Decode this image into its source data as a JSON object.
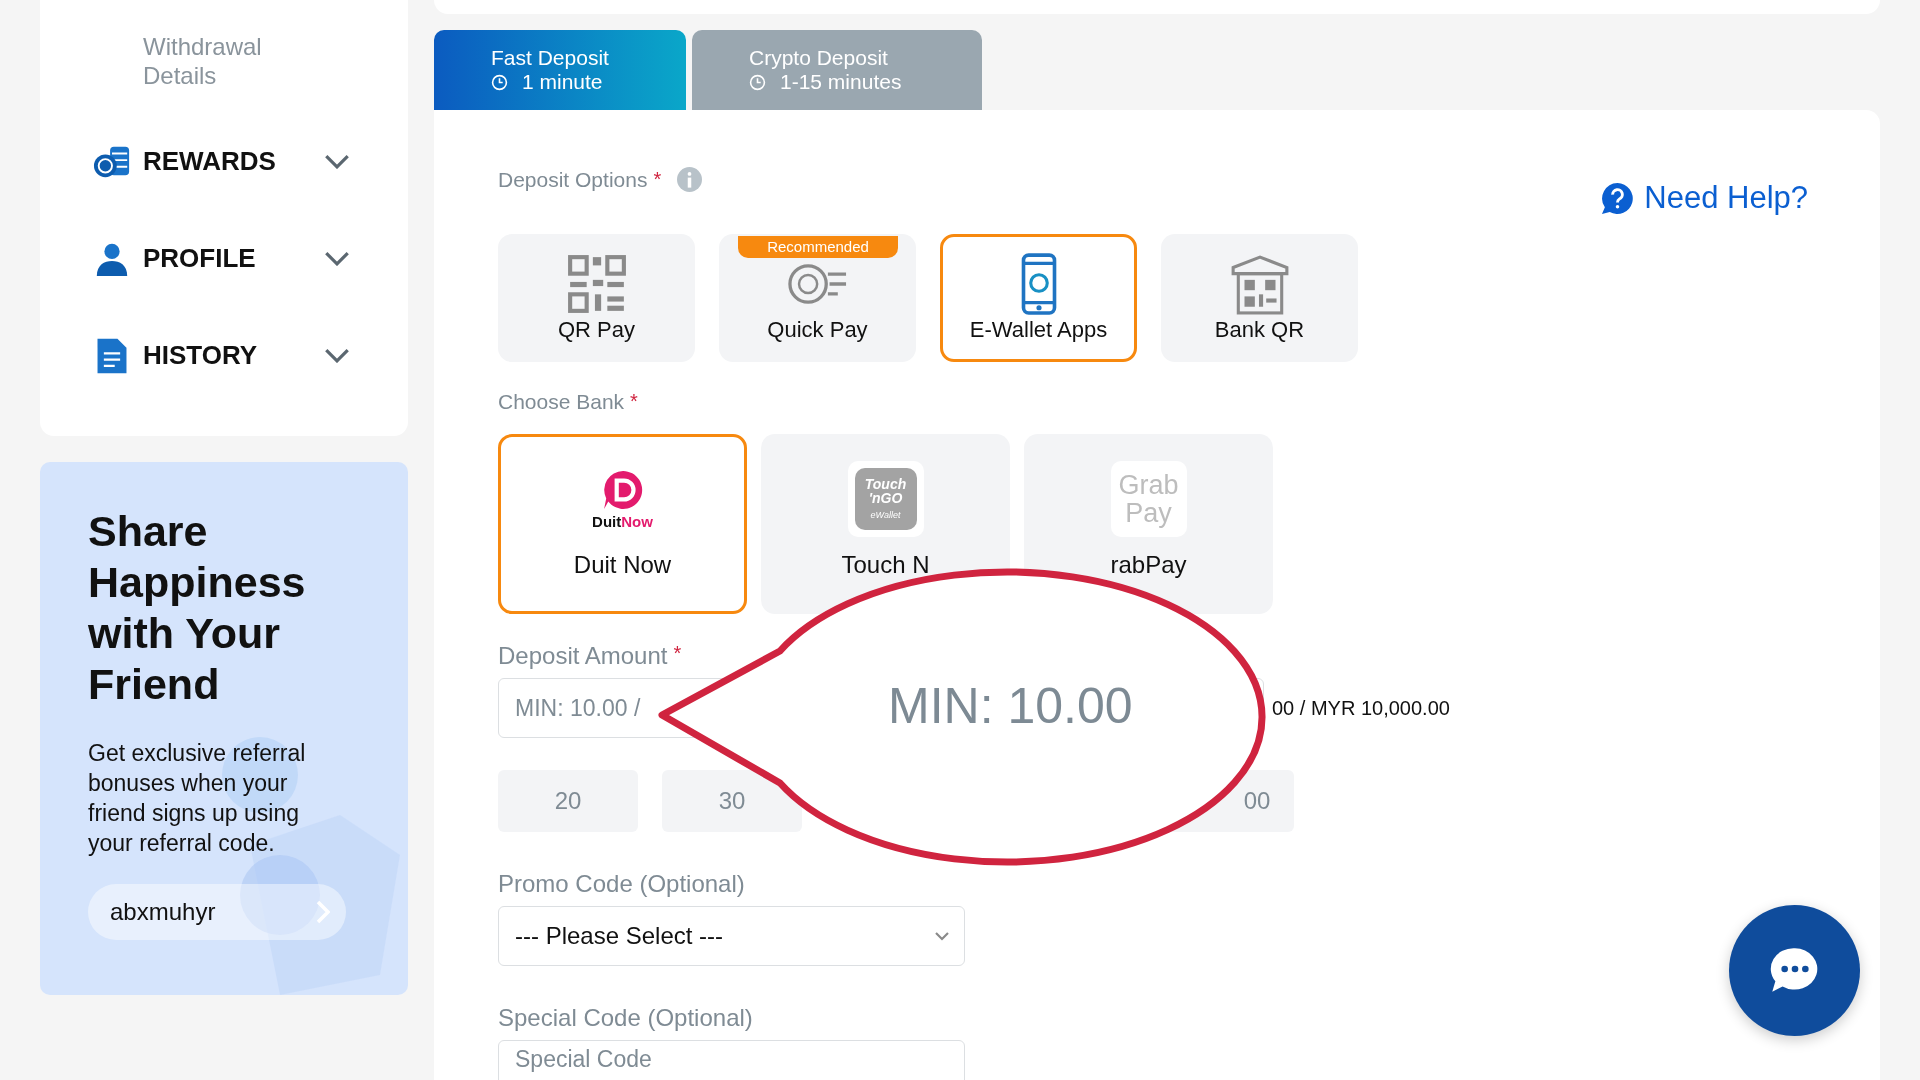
{
  "sidebar": {
    "sub_item": "Withdrawal Details",
    "sections": [
      {
        "kind": "rewards",
        "label": "REWARDS",
        "expanded": false
      },
      {
        "kind": "profile",
        "label": "PROFILE",
        "expanded": false
      },
      {
        "kind": "history",
        "label": "HISTORY",
        "expanded": false
      }
    ]
  },
  "referral": {
    "title": "Share Happiness with Your Friend",
    "text": "Get exclusive referral bonuses when your friend signs up using your referral code.",
    "code": "abxmuhyr"
  },
  "tabs": [
    {
      "title": "Fast Deposit",
      "time": "1 minute",
      "selected": true
    },
    {
      "title": "Crypto Deposit",
      "time": "1-15 minutes",
      "selected": false
    }
  ],
  "deposit_options": {
    "label": "Deposit Options",
    "required": "*",
    "help": "Need Help?",
    "items": [
      {
        "kind": "qr",
        "label": "QR Pay",
        "selected": false
      },
      {
        "kind": "quick",
        "label": "Quick Pay",
        "badge": "Recommended",
        "selected": false
      },
      {
        "kind": "wallet",
        "label": "E-Wallet Apps",
        "selected": true
      },
      {
        "kind": "bankqr",
        "label": "Bank QR",
        "selected": false
      }
    ]
  },
  "choose_bank": {
    "label": "Choose Bank",
    "required": "*",
    "items": [
      {
        "kind": "duitnow",
        "logo_text": [
          "Duit",
          "Now"
        ],
        "label": "Duit Now",
        "selected": true
      },
      {
        "kind": "tng",
        "logo_text": [
          "Touch",
          "'nGO",
          "eWallet"
        ],
        "label": "Touch N",
        "selected": false
      },
      {
        "kind": "grab",
        "logo_text": [
          "Grab",
          "Pay"
        ],
        "label": "rabPay",
        "selected": false
      }
    ]
  },
  "deposit_amount": {
    "label": "Deposit Amount",
    "required": "*",
    "placeholder": "MIN: 10.00 /",
    "hint": "00 / MYR 10,000.00",
    "amounts": [
      "20",
      "30",
      "00"
    ]
  },
  "callout": {
    "text": "MIN: 10.00"
  },
  "promo_code": {
    "label": "Promo Code (Optional)",
    "value": "--- Please Select ---"
  },
  "special_code": {
    "label": "Special Code (Optional)",
    "placeholder": "Special Code"
  }
}
